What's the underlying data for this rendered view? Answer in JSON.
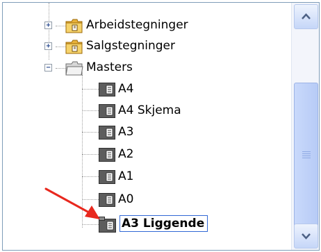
{
  "tree": {
    "items": [
      {
        "label": "Arbeidstegninger",
        "expander": "+",
        "icon": "folder-icon"
      },
      {
        "label": "Salgstegninger",
        "expander": "+",
        "icon": "folder-icon"
      },
      {
        "label": "Masters",
        "expander": "−",
        "icon": "folder-open-icon"
      },
      {
        "label": "A4",
        "icon": "master-page-icon"
      },
      {
        "label": "A4 Skjema",
        "icon": "master-page-icon"
      },
      {
        "label": "A3",
        "icon": "master-page-icon"
      },
      {
        "label": "A2",
        "icon": "master-page-icon"
      },
      {
        "label": "A1",
        "icon": "master-page-icon"
      },
      {
        "label": "A0",
        "icon": "master-page-icon"
      },
      {
        "label": "A3 Liggende",
        "icon": "master-page-icon",
        "selected": true
      }
    ]
  },
  "scrollbar": {
    "up_icon": "scroll-up-icon",
    "down_icon": "scroll-down-icon"
  },
  "annotation": {
    "icon": "red-arrow-icon",
    "color": "#e8281e"
  },
  "colors": {
    "selection_border": "#3168d5",
    "frame_border": "#7f9db9"
  }
}
